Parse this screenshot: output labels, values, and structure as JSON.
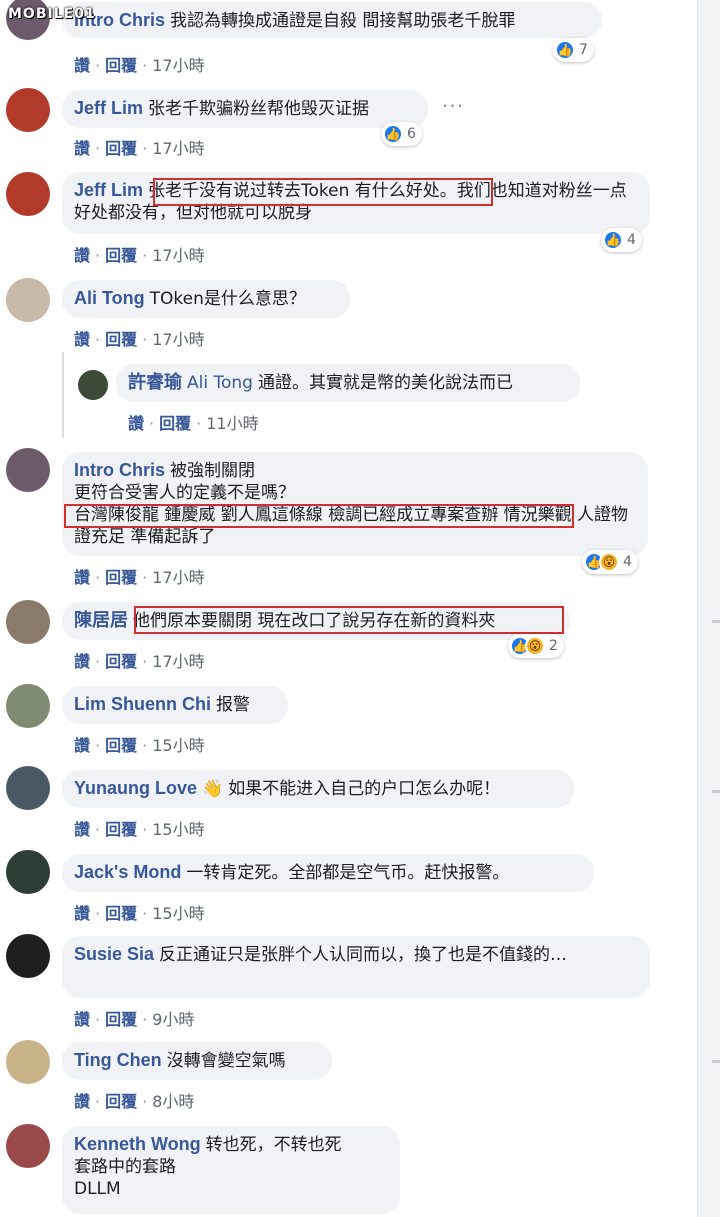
{
  "watermark": "MOBILE01",
  "actions": {
    "like": "讚",
    "reply": "回覆"
  },
  "comments": [
    {
      "author": "Intro Chris",
      "tag": "",
      "text": "我認為轉換成通證是自殺 間接幫助張老千脫罪",
      "time": "17小時",
      "reactions": "7",
      "react_types": [
        "like"
      ],
      "avatar_color": "#6d5a6a"
    },
    {
      "author": "Jeff Lim",
      "tag": "",
      "text": "张老千欺骗粉丝帮他毁灭证据",
      "time": "17小時",
      "reactions": "6",
      "react_types": [
        "like"
      ],
      "avatar_color": "#b23a2a",
      "more": "···"
    },
    {
      "author": "Jeff Lim",
      "tag": "",
      "text": "张老千没有说过转去Token 有什么好处。我们也知道对粉丝一点好处都没有，但对他就可以脱身",
      "time": "17小時",
      "reactions": "4",
      "react_types": [
        "like"
      ],
      "avatar_color": "#b23a2a"
    },
    {
      "author": "Ali Tong",
      "tag": "",
      "text": "TOken是什么意思？",
      "time": "17小時",
      "reactions": "",
      "react_types": [],
      "avatar_color": "#c8b8a8"
    },
    {
      "author": "許睿瑜",
      "tag": "Ali Tong",
      "text": "通證。其實就是幣的美化說法而已",
      "time": "11小時",
      "reactions": "",
      "react_types": [],
      "avatar_color": "#3d4a38",
      "reply": true
    },
    {
      "author": "Intro Chris",
      "tag": "",
      "text": "被強制關閉\n更符合受害人的定義不是嗎？\n台灣陳俊龍 鍾慶威 劉人鳳這條線 檢調已經成立專案查辦 情況樂觀 人證物證充足 準備起訴了",
      "time": "17小時",
      "reactions": "4",
      "react_types": [
        "like",
        "wow"
      ],
      "avatar_color": "#6d5a6a"
    },
    {
      "author": "陳居居",
      "tag": "",
      "text": "他們原本要關閉 現在改口了說另存在新的資料夾",
      "time": "17小時",
      "reactions": "2",
      "react_types": [
        "like",
        "wow"
      ],
      "avatar_color": "#8a7a6a"
    },
    {
      "author": "Lim Shuenn Chi",
      "tag": "",
      "text": "报警",
      "time": "15小時",
      "reactions": "",
      "react_types": [],
      "avatar_color": "#7e8a72"
    },
    {
      "author": "Yunaung Love",
      "tag": "",
      "text": "如果不能进入自己的户口怎么办呢！",
      "time": "15小時",
      "reactions": "",
      "react_types": [],
      "avatar_color": "#4a5866",
      "emoji": "👋"
    },
    {
      "author": "Jack's Mond",
      "tag": "",
      "text": "一转肯定死。全部都是空气币。赶快报警。",
      "time": "15小時",
      "reactions": "",
      "react_types": [],
      "avatar_color": "#2e3d35"
    },
    {
      "author": "Susie Sia",
      "tag": "",
      "text": "反正通证只是张胖个人认同而以，換了也是不值錢的…",
      "time": "9小時",
      "reactions": "",
      "react_types": [],
      "avatar_color": "#1f1f1f"
    },
    {
      "author": "Ting Chen",
      "tag": "",
      "text": "沒轉會變空氣嗎",
      "time": "8小時",
      "reactions": "",
      "react_types": [],
      "avatar_color": "#c9b48a"
    },
    {
      "author": "Kenneth Wong",
      "tag": "",
      "text": "转也死，不转也死\n套路中的套路\nDLLM",
      "time": "",
      "reactions": "",
      "react_types": [],
      "avatar_color": "#9a4a4a"
    }
  ]
}
